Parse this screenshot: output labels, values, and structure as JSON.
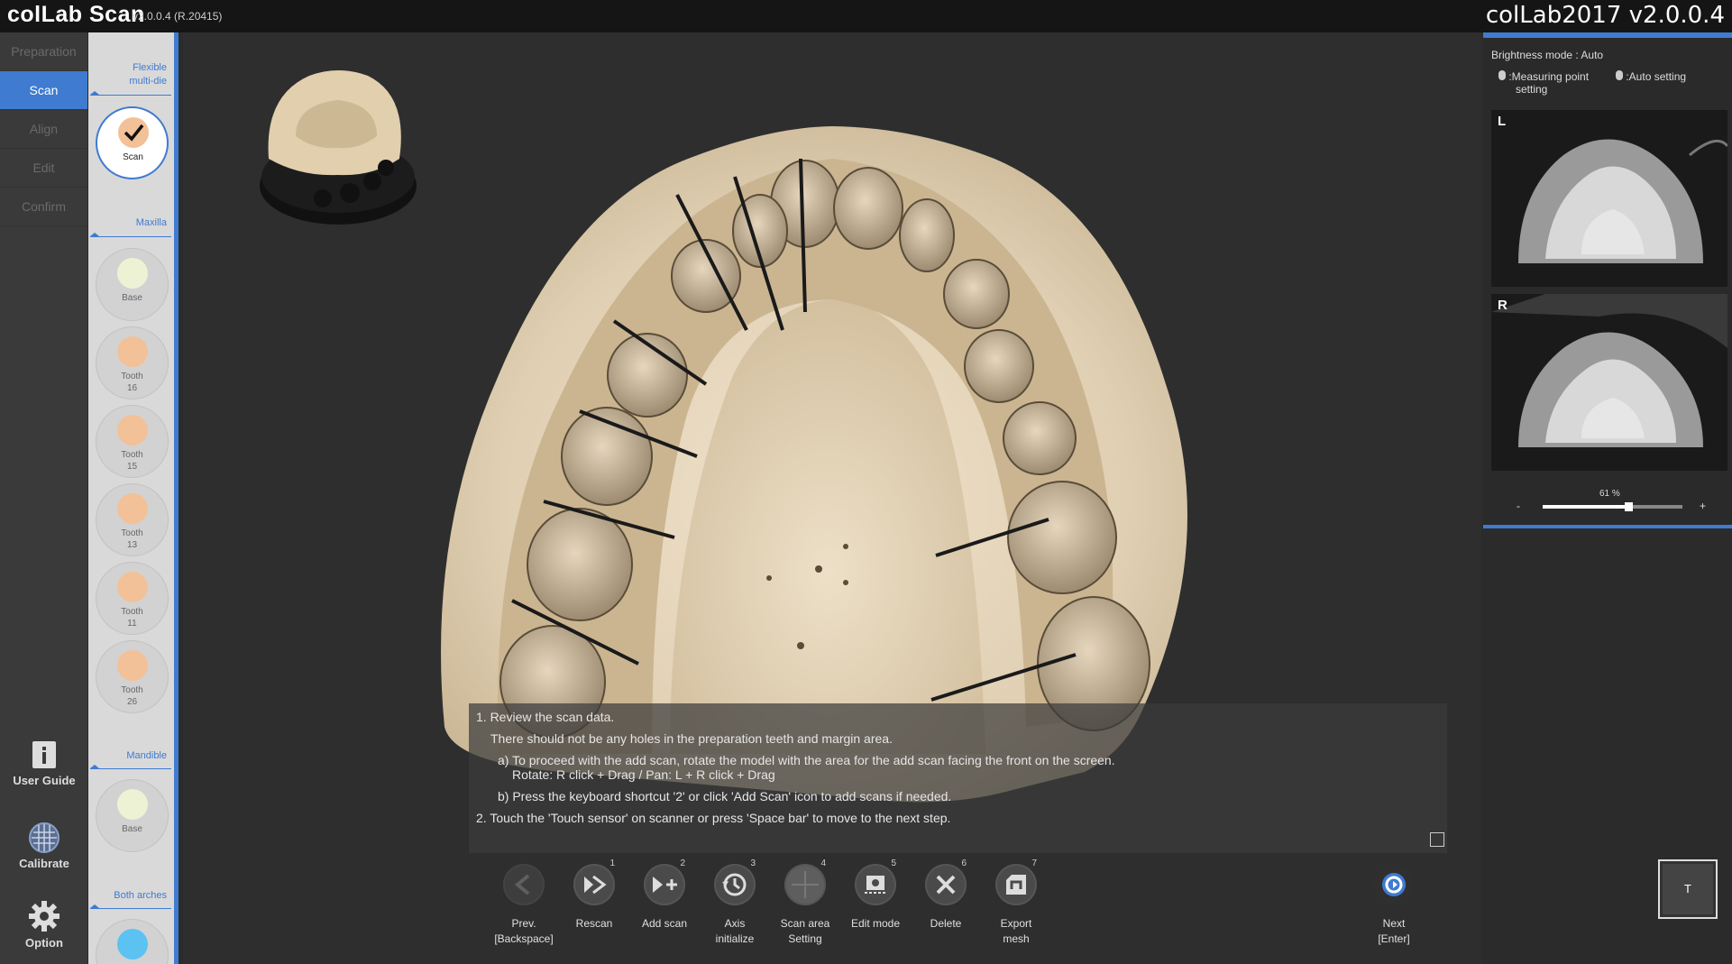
{
  "app": {
    "logo": "colLab Scan",
    "version": "v2.0.0.4 (R.20415)",
    "title_right": "colLab2017 v2.0.0.4"
  },
  "steps": [
    {
      "label": "Preparation"
    },
    {
      "label": "Scan"
    },
    {
      "label": "Align"
    },
    {
      "label": "Edit"
    },
    {
      "label": "Confirm"
    }
  ],
  "tools": {
    "user_guide": "User Guide",
    "calibrate": "Calibrate",
    "option": "Option"
  },
  "sidepanel": {
    "flexible": "Flexible multi-die",
    "scan": "Scan",
    "maxilla": "Maxilla",
    "mandible": "Mandible",
    "both_arches": "Both arches",
    "maxilla_items": [
      {
        "label": "Base",
        "color": "#eef2d5"
      },
      {
        "label": "Tooth 16",
        "color": "#f3c197"
      },
      {
        "label": "Tooth 15",
        "color": "#f3c197"
      },
      {
        "label": "Tooth 13",
        "color": "#f3c197"
      },
      {
        "label": "Tooth 11",
        "color": "#f3c197"
      },
      {
        "label": "Tooth 26",
        "color": "#f3c197"
      }
    ],
    "mandible_items": [
      {
        "label": "Base",
        "color": "#eef2d5"
      }
    ],
    "both_color": "#5bc2f2"
  },
  "instructions": {
    "line1": "1. Review the scan data.",
    "line2": "There should not be any holes in the preparation teeth and margin area.",
    "line3": "a) To proceed with the add scan, rotate the model with the area for the add scan facing the front on the screen.",
    "line4": "Rotate: R click + Drag / Pan: L + R click + Drag",
    "line5": "b) Press the keyboard shortcut '2' or click 'Add Scan' icon to add scans if needed.",
    "line6": "2. Touch the 'Touch sensor' on scanner or press 'Space bar' to move to the next step."
  },
  "toolbar": [
    {
      "label": "Prev. [Backspace]",
      "num": "",
      "icon": "prev-icon"
    },
    {
      "label": "Rescan",
      "num": "1",
      "icon": "rescan-icon"
    },
    {
      "label": "Add scan",
      "num": "2",
      "icon": "add-scan-icon"
    },
    {
      "label": "Axis initialize",
      "num": "3",
      "icon": "axis-icon"
    },
    {
      "label": "Scan area Setting",
      "num": "4",
      "icon": "scan-area-icon"
    },
    {
      "label": "Edit mode",
      "num": "5",
      "icon": "edit-mode-icon"
    },
    {
      "label": "Delete",
      "num": "6",
      "icon": "delete-icon"
    },
    {
      "label": "Export mesh",
      "num": "7",
      "icon": "export-icon"
    }
  ],
  "next": {
    "label1": "Next",
    "label2": "[Enter]"
  },
  "right_panel": {
    "brightness": "Brightness mode : Auto",
    "measuring": ":Measuring point",
    "measuring2": "setting",
    "auto": ":Auto setting",
    "cam_l": "L",
    "cam_r": "R",
    "percent_label": "61 %",
    "percent_value": 0.61,
    "minus": "-",
    "plus": "+"
  },
  "t_button": "T",
  "colors": {
    "accent": "#3f7bd0",
    "model": "#e3d3b9"
  }
}
